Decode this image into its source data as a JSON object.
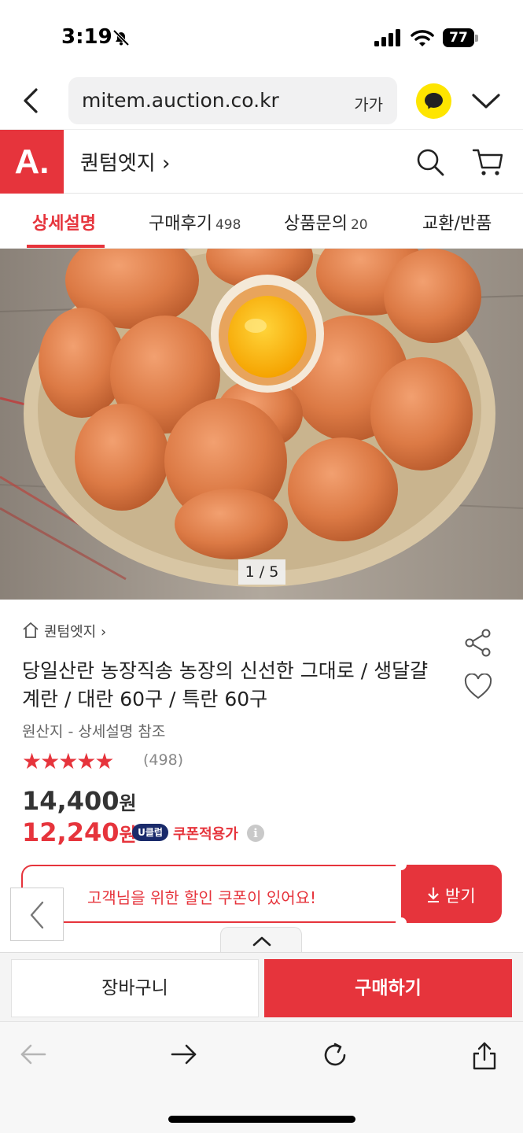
{
  "status_bar": {
    "time": "3:19",
    "battery": "77"
  },
  "browser": {
    "url": "mitem.auction.co.kr",
    "text_size_label": "가가"
  },
  "site": {
    "logo": "A.",
    "shop_name": "퀀텀엣지 ›",
    "brand_color": "#e6343c"
  },
  "tabs": [
    {
      "label": "상세설명",
      "count": ""
    },
    {
      "label": "구매후기",
      "count": "498"
    },
    {
      "label": "상품문의",
      "count": "20"
    },
    {
      "label": "교환/반품",
      "count": ""
    }
  ],
  "gallery": {
    "pager": "1 / 5"
  },
  "product": {
    "store_link": "퀀텀엣지 ›",
    "title": "당일산란 농장직송 농장의 신선한 그대로 / 생달걀 계란 / 대란 60구 / 특란 60구",
    "origin": "원산지 - 상세설명 참조",
    "stars": "★★★★★",
    "rating_value": 5,
    "review_count": "(498)",
    "original_price": "14,400",
    "sale_price": "12,240",
    "currency": "원",
    "uclub_badge": "U클럽",
    "coupon_label": "쿠폰적용가",
    "info_glyph": "i"
  },
  "coupon": {
    "banner_text": "고객님을 위한 할인 쿠폰이 있어요!",
    "button_label": "받기"
  },
  "actions": {
    "cart_label": "장바구니",
    "buy_label": "구매하기"
  }
}
